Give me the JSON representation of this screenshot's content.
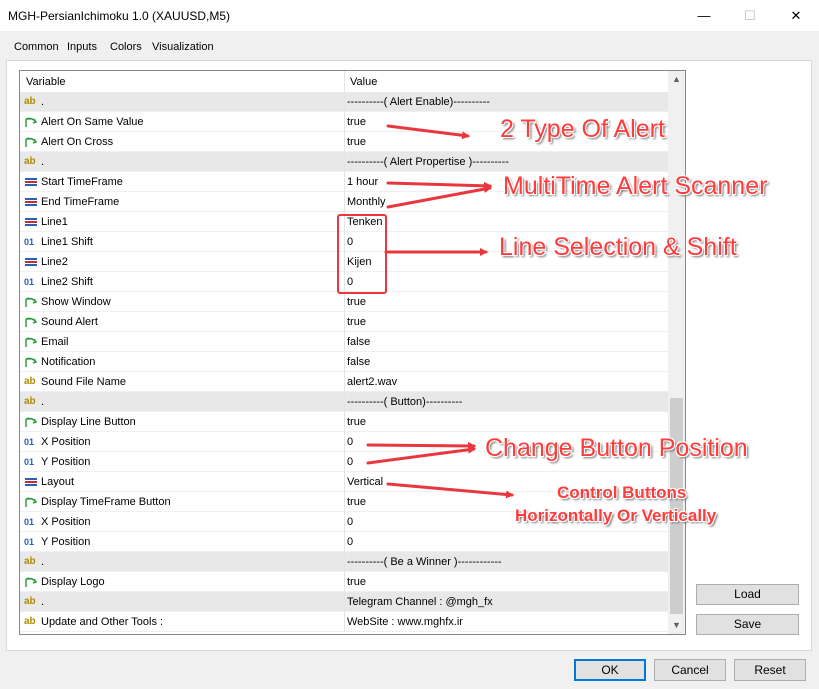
{
  "window": {
    "title": "MGH-PersianIchimoku 1.0 (XAUUSD,M5)",
    "minimize_glyph": "—",
    "maximize_glyph": "☐",
    "close_glyph": "✕"
  },
  "tabs": [
    {
      "label": "Common",
      "active": false
    },
    {
      "label": "Inputs",
      "active": true
    },
    {
      "label": "Colors",
      "active": false
    },
    {
      "label": "Visualization",
      "active": false
    }
  ],
  "grid": {
    "col_variable": "Variable",
    "col_value": "Value",
    "rows": [
      {
        "icon": "ab",
        "variable": ".",
        "value": "----------( Alert Enable)----------",
        "sep": true
      },
      {
        "icon": "bool",
        "variable": "Alert On Same Value",
        "value": "true"
      },
      {
        "icon": "bool",
        "variable": "Alert On Cross",
        "value": "true"
      },
      {
        "icon": "ab",
        "variable": ".",
        "value": "----------( Alert Propertise )----------",
        "sep": true
      },
      {
        "icon": "enum",
        "variable": "Start TimeFrame",
        "value": "1 hour"
      },
      {
        "icon": "enum",
        "variable": "End TimeFrame",
        "value": "Monthly"
      },
      {
        "icon": "enum",
        "variable": "Line1",
        "value": "Tenken"
      },
      {
        "icon": "num",
        "variable": "Line1 Shift",
        "value": "0"
      },
      {
        "icon": "enum",
        "variable": "Line2",
        "value": "Kijen"
      },
      {
        "icon": "num",
        "variable": "Line2 Shift",
        "value": "0"
      },
      {
        "icon": "bool",
        "variable": "Show Window",
        "value": "true"
      },
      {
        "icon": "bool",
        "variable": "Sound Alert",
        "value": "true"
      },
      {
        "icon": "bool",
        "variable": "Email",
        "value": "false"
      },
      {
        "icon": "bool",
        "variable": "Notification",
        "value": "false"
      },
      {
        "icon": "ab",
        "variable": "Sound File Name",
        "value": "alert2.wav"
      },
      {
        "icon": "ab",
        "variable": ".",
        "value": "----------( Button)----------",
        "sep": true
      },
      {
        "icon": "bool",
        "variable": "Display Line Button",
        "value": "true"
      },
      {
        "icon": "num",
        "variable": "X Position",
        "value": "0"
      },
      {
        "icon": "num",
        "variable": "Y Position",
        "value": "0"
      },
      {
        "icon": "enum",
        "variable": "Layout",
        "value": "Vertical"
      },
      {
        "icon": "bool",
        "variable": "Display TimeFrame Button",
        "value": "true"
      },
      {
        "icon": "num",
        "variable": "X Position",
        "value": "0"
      },
      {
        "icon": "num",
        "variable": "Y Position",
        "value": "0"
      },
      {
        "icon": "ab",
        "variable": ".",
        "value": "----------( Be a Winner )------------",
        "sep": true
      },
      {
        "icon": "bool",
        "variable": "Display Logo",
        "value": "true"
      },
      {
        "icon": "ab",
        "variable": ".",
        "value": "Telegram Channel : @mgh_fx",
        "sep": true
      },
      {
        "icon": "ab",
        "variable": "Update and Other Tools :",
        "value": "WebSite : www.mghfx.ir"
      }
    ]
  },
  "side_buttons": {
    "load": "Load",
    "save": "Save"
  },
  "footer_buttons": {
    "ok": "OK",
    "cancel": "Cancel",
    "reset": "Reset"
  },
  "annotations": {
    "two_type": "2 Type Of Alert",
    "multitime": "MultiTime Alert Scanner",
    "line_selection": "Line Selection & Shift",
    "change_position": "Change Button Position",
    "control_line1": "Control Buttons",
    "control_line2": "Horizontally Or Vertically"
  },
  "icon_glyphs": {
    "ab": "ab",
    "num": "01"
  },
  "colors": {
    "annotation_red": "#e8383d",
    "ok_border": "#0078d7",
    "bool_icon_green": "#2e9e3e",
    "enum_icon_blue": "#2d5fb7"
  }
}
